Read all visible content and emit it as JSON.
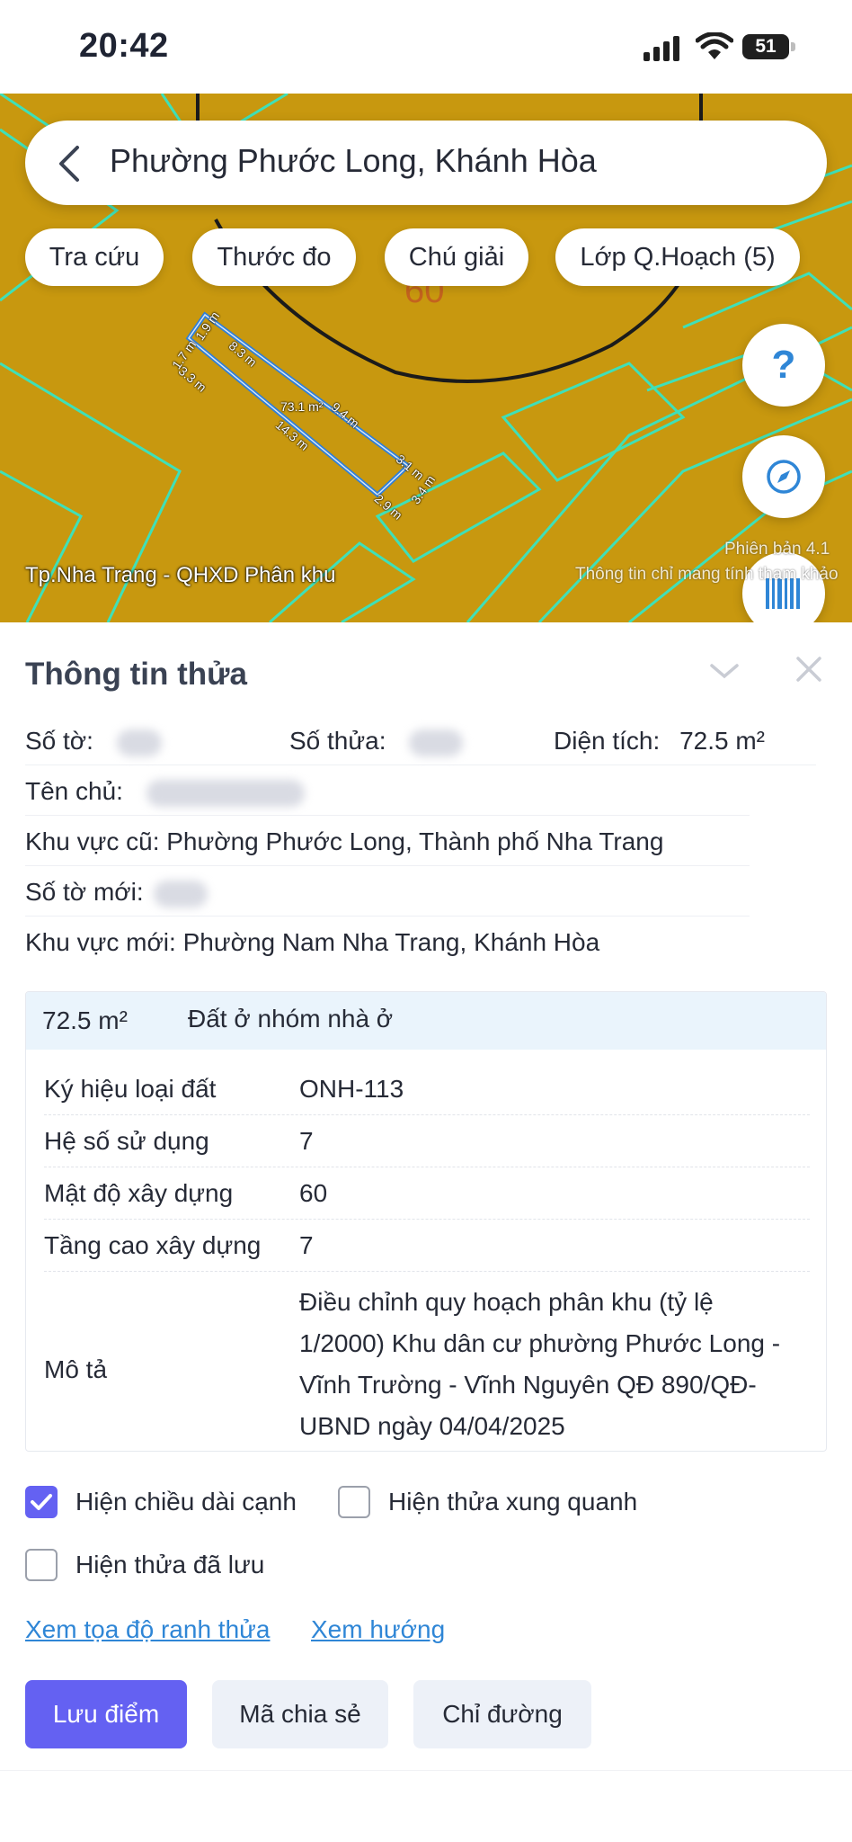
{
  "status_bar": {
    "time": "20:42",
    "battery": "51"
  },
  "map": {
    "search_title": "Phường Phước Long, Khánh Hòa",
    "chips": [
      "Tra cứu",
      "Thước đo",
      "Chú giải",
      "Lớp Q.Hoạch (5)"
    ],
    "help_symbol": "?",
    "zone_number": "60",
    "layer_label": "Tp.Nha Trang - QHXD Phân khu",
    "version_text": "Phiên bản 4.1",
    "disclaimer": "Thông tin chỉ mang tính tham khảo",
    "dimensions": {
      "d1": "1.7 m",
      "d2": "1.9 m",
      "d3": "8.3 m",
      "d4": "3.3 m",
      "d5": "9.4 m",
      "area": "73.1 m²",
      "d6": "14.3 m",
      "d7": "3.1 m",
      "d8": "2.9 m",
      "d9": "3.4 m"
    },
    "colors": {
      "land": "#c8980f",
      "boundary": "#3fe0b8",
      "parcel": "#2f7fd8"
    }
  },
  "panel": {
    "title": "Thông tin thửa",
    "so_to_label": "Số tờ:",
    "so_thua_label": "Số thửa:",
    "dien_tich_label": "Diện tích:",
    "dien_tich_value": "72.5 m²",
    "ten_chu_label": "Tên chủ:",
    "khu_vuc_cu": "Khu vực cũ: Phường Phước Long, Thành phố Nha Trang",
    "so_to_moi_label": "Số tờ mới:",
    "khu_vuc_moi": "Khu vực mới: Phường Nam Nha Trang, Khánh Hòa",
    "card": {
      "area": "72.5 m²",
      "land_use": "Đất ở nhóm nhà ở",
      "rows": [
        {
          "key": "Ký hiệu loại đất",
          "value": "ONH-113"
        },
        {
          "key": "Hệ số sử dụng",
          "value": "7"
        },
        {
          "key": "Mật độ xây dựng",
          "value": "60"
        },
        {
          "key": "Tầng cao xây dựng",
          "value": "7"
        }
      ],
      "desc_key": "Mô tả",
      "desc_value": "Điều chỉnh quy hoạch phân khu (tỷ lệ 1/2000) Khu dân cư phường Phước Long - Vĩnh Trường - Vĩnh Nguyên QĐ 890/QĐ-UBND ngày 04/04/2025"
    },
    "checkboxes": {
      "show_edges": {
        "label": "Hiện chiều dài cạnh",
        "checked": true
      },
      "show_neighbors": {
        "label": "Hiện thửa xung quanh",
        "checked": false
      },
      "show_saved": {
        "label": "Hiện thửa đã lưu",
        "checked": false
      }
    },
    "links": {
      "coords": "Xem tọa độ ranh thửa",
      "direction": "Xem hướng"
    },
    "buttons": {
      "save": "Lưu điểm",
      "share": "Mã chia sẻ",
      "directions": "Chỉ đường"
    },
    "accent": "#6461f2"
  }
}
